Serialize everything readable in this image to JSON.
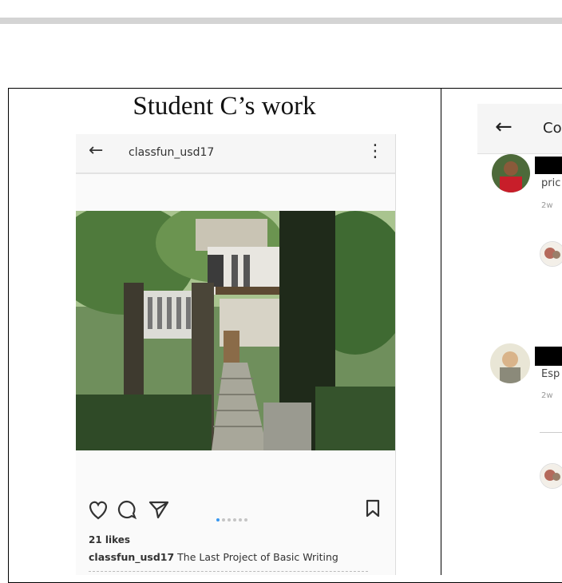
{
  "figure": {
    "caption": "Student C’s work"
  },
  "post": {
    "username": "classfun_usd17",
    "likes": "21 likes",
    "caption_user": "classfun_usd17",
    "caption_text": " The Last Project of Basic Writing",
    "carousel_count": 6,
    "carousel_active_index": 0
  },
  "icons": {
    "back": "back-arrow-icon",
    "more": "more-vertical-icon",
    "like": "heart-icon",
    "comment": "comment-icon",
    "share": "send-icon",
    "save": "bookmark-icon"
  },
  "comments_panel": {
    "title": "Co",
    "comments": [
      {
        "text": "pric",
        "time": "2w"
      },
      {
        "text": "Esp",
        "time": "2w"
      }
    ]
  },
  "colors": {
    "accent": "#3897f0",
    "header_bg": "#f6f6f6"
  }
}
